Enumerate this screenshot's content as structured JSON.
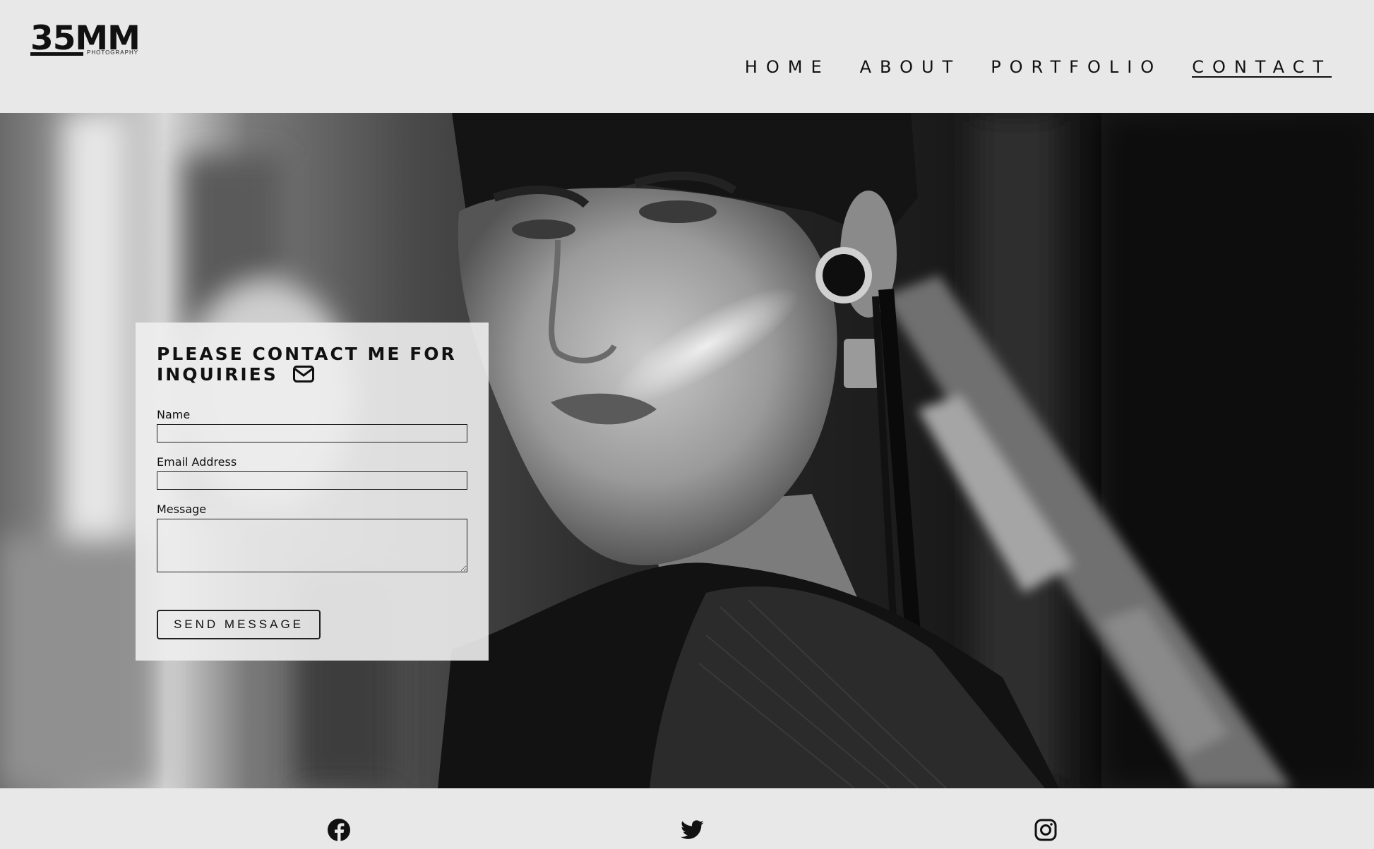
{
  "brand": {
    "logo_main": "35MM",
    "logo_sub": "PHOTOGRAPHY"
  },
  "nav": {
    "items": [
      {
        "label": "HOME",
        "active": false
      },
      {
        "label": "ABOUT",
        "active": false
      },
      {
        "label": "PORTFOLIO",
        "active": false
      },
      {
        "label": "CONTACT",
        "active": true
      }
    ]
  },
  "contact_form": {
    "title": "PLEASE CONTACT ME FOR INQUIRIES",
    "title_icon": "envelope-icon",
    "name_label": "Name",
    "name_value": "",
    "email_label": "Email Address",
    "email_value": "",
    "message_label": "Message",
    "message_value": "",
    "send_label": "SEND MESSAGE"
  },
  "footer": {
    "social_icons": [
      "facebook-icon",
      "twitter-icon",
      "instagram-icon"
    ]
  },
  "colors": {
    "background": "#e8e8e8",
    "text": "#111111",
    "card": "#eeeeee"
  }
}
